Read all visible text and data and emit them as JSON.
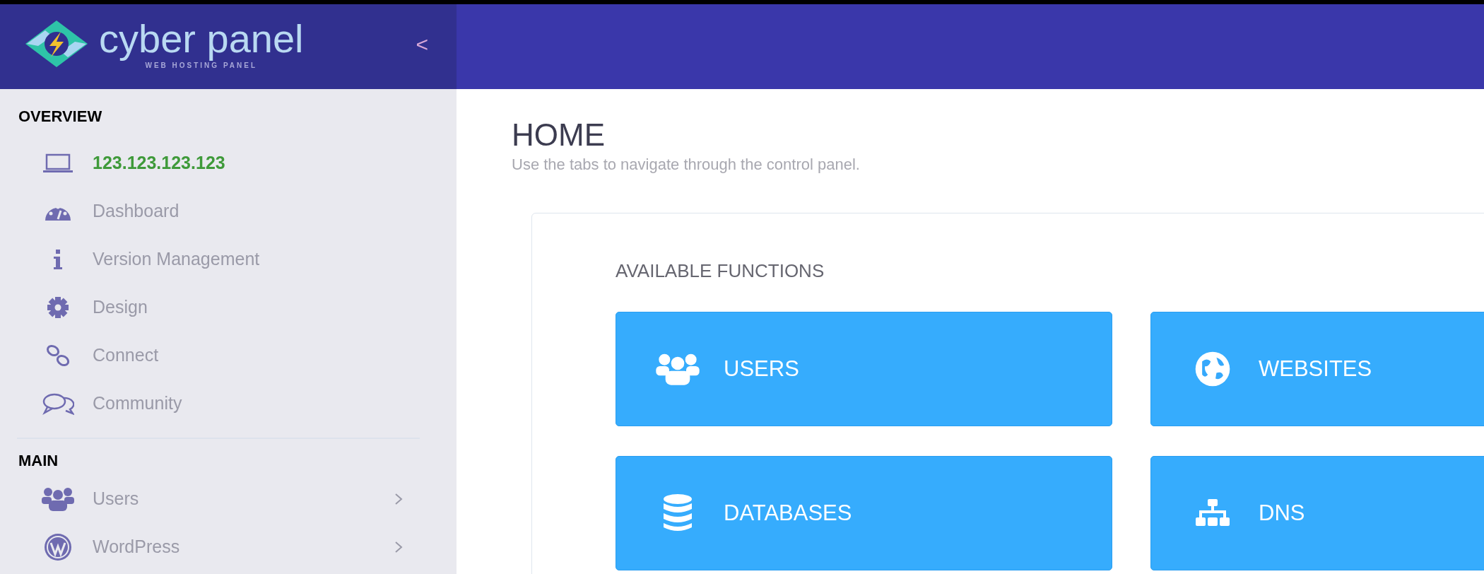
{
  "brand": {
    "name": "cyber panel",
    "tagline": "WEB HOSTING PANEL",
    "collapse": "<"
  },
  "sidebar": {
    "sections": [
      {
        "title": "OVERVIEW",
        "items": [
          {
            "label": "123.123.123.123",
            "kind": "address",
            "has_submenu": false
          },
          {
            "label": "Dashboard",
            "kind": "link",
            "has_submenu": false
          },
          {
            "label": "Version Management",
            "kind": "link",
            "has_submenu": false
          },
          {
            "label": "Design",
            "kind": "link",
            "has_submenu": false
          },
          {
            "label": "Connect",
            "kind": "link",
            "has_submenu": false
          },
          {
            "label": "Community",
            "kind": "link",
            "has_submenu": false
          }
        ]
      },
      {
        "title": "MAIN",
        "items": [
          {
            "label": "Users",
            "kind": "link",
            "has_submenu": true
          },
          {
            "label": "WordPress",
            "kind": "link",
            "has_submenu": true
          }
        ]
      }
    ]
  },
  "page": {
    "title": "HOME",
    "subtitle": "Use the tabs to navigate through the control panel."
  },
  "functions": {
    "title": "AVAILABLE FUNCTIONS",
    "tiles": [
      {
        "label": "USERS"
      },
      {
        "label": "WEBSITES"
      },
      {
        "label": "DATABASES"
      },
      {
        "label": "DNS"
      }
    ]
  }
}
